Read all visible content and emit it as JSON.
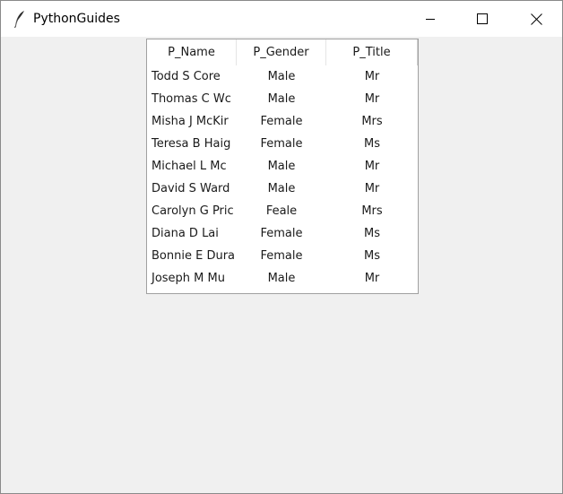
{
  "window": {
    "title": "PythonGuides",
    "app_icon": "feather-icon",
    "controls": {
      "minimize_icon": "minimize-icon",
      "maximize_icon": "maximize-icon",
      "close_icon": "close-icon"
    }
  },
  "table": {
    "columns": [
      "P_Name",
      "P_Gender",
      "P_Title"
    ],
    "rows": [
      [
        "Todd S Core",
        "Male",
        "Mr"
      ],
      [
        "Thomas C Wc",
        "Male",
        "Mr"
      ],
      [
        "Misha J McKir",
        "Female",
        "Mrs"
      ],
      [
        "Teresa B Haig",
        "Female",
        "Ms"
      ],
      [
        "Michael L Mc",
        "Male",
        "Mr"
      ],
      [
        "David S Ward",
        "Male",
        "Mr"
      ],
      [
        "Carolyn G Pric",
        "Feale",
        "Mrs"
      ],
      [
        "Diana D Lai",
        "Female",
        "Ms"
      ],
      [
        "Bonnie E Dura",
        "Female",
        "Ms"
      ],
      [
        "Joseph M Mu",
        "Male",
        "Mr"
      ]
    ]
  }
}
